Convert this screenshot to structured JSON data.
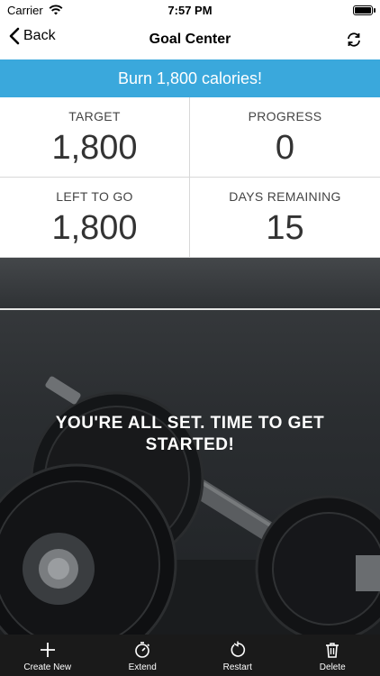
{
  "status_bar": {
    "carrier": "Carrier",
    "time": "7:57 PM"
  },
  "nav": {
    "back_label": "Back",
    "title": "Goal Center",
    "refresh_icon": "refresh-icon"
  },
  "banner": {
    "text": "Burn 1,800 calories!",
    "color": "#3aa8dc"
  },
  "stats": [
    {
      "label": "TARGET",
      "value": "1,800"
    },
    {
      "label": "PROGRESS",
      "value": "0"
    },
    {
      "label": "LEFT TO GO",
      "value": "1,800"
    },
    {
      "label": "DAYS REMAINING",
      "value": "15"
    }
  ],
  "hero": {
    "message": "YOU'RE ALL SET. TIME TO GET STARTED!"
  },
  "tab_bar": {
    "items": [
      {
        "label": "Create New",
        "icon": "plus-icon"
      },
      {
        "label": "Extend",
        "icon": "stopwatch-icon"
      },
      {
        "label": "Restart",
        "icon": "restart-icon"
      },
      {
        "label": "Delete",
        "icon": "trash-icon"
      }
    ]
  }
}
